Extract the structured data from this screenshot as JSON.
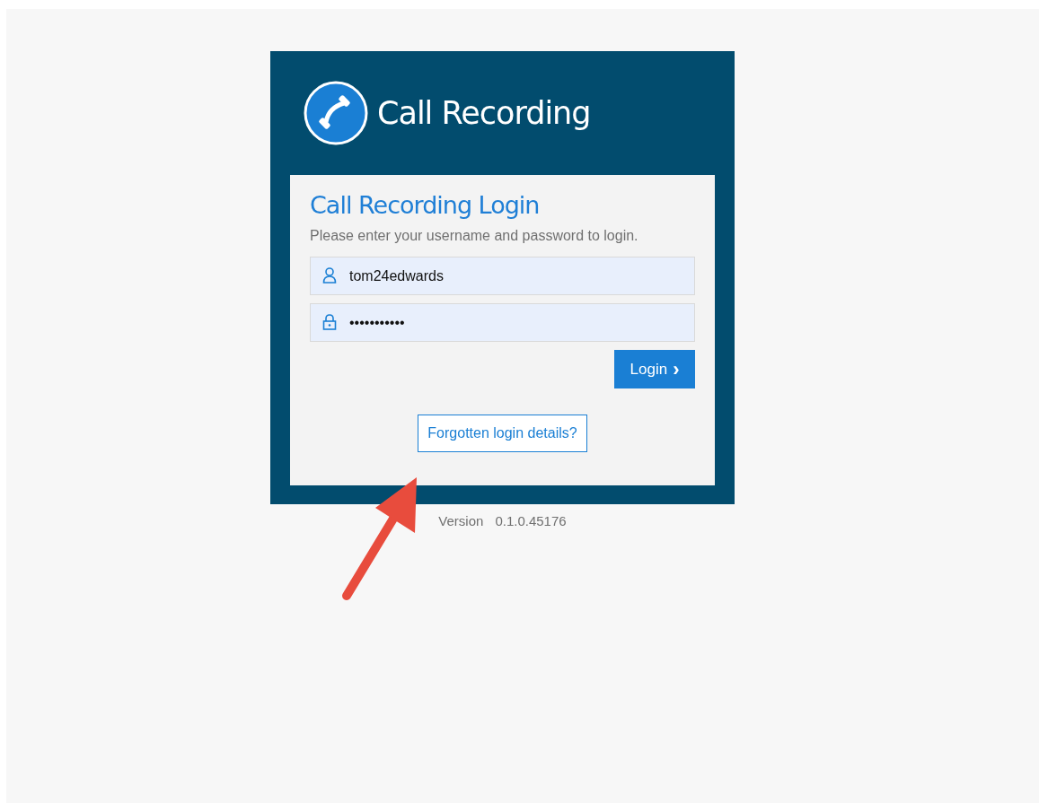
{
  "header": {
    "title": "Call Recording"
  },
  "login_panel": {
    "heading": "Call Recording Login",
    "instructions": "Please enter your username and password to login.",
    "username": {
      "value": "tom24edwards"
    },
    "password": {
      "value": "•••••••••••"
    },
    "login_button": {
      "label": "Login",
      "caret": "›"
    },
    "forgot_link": "Forgotten login details?"
  },
  "version": {
    "label": "Version",
    "number": "0.1.0.45176"
  }
}
